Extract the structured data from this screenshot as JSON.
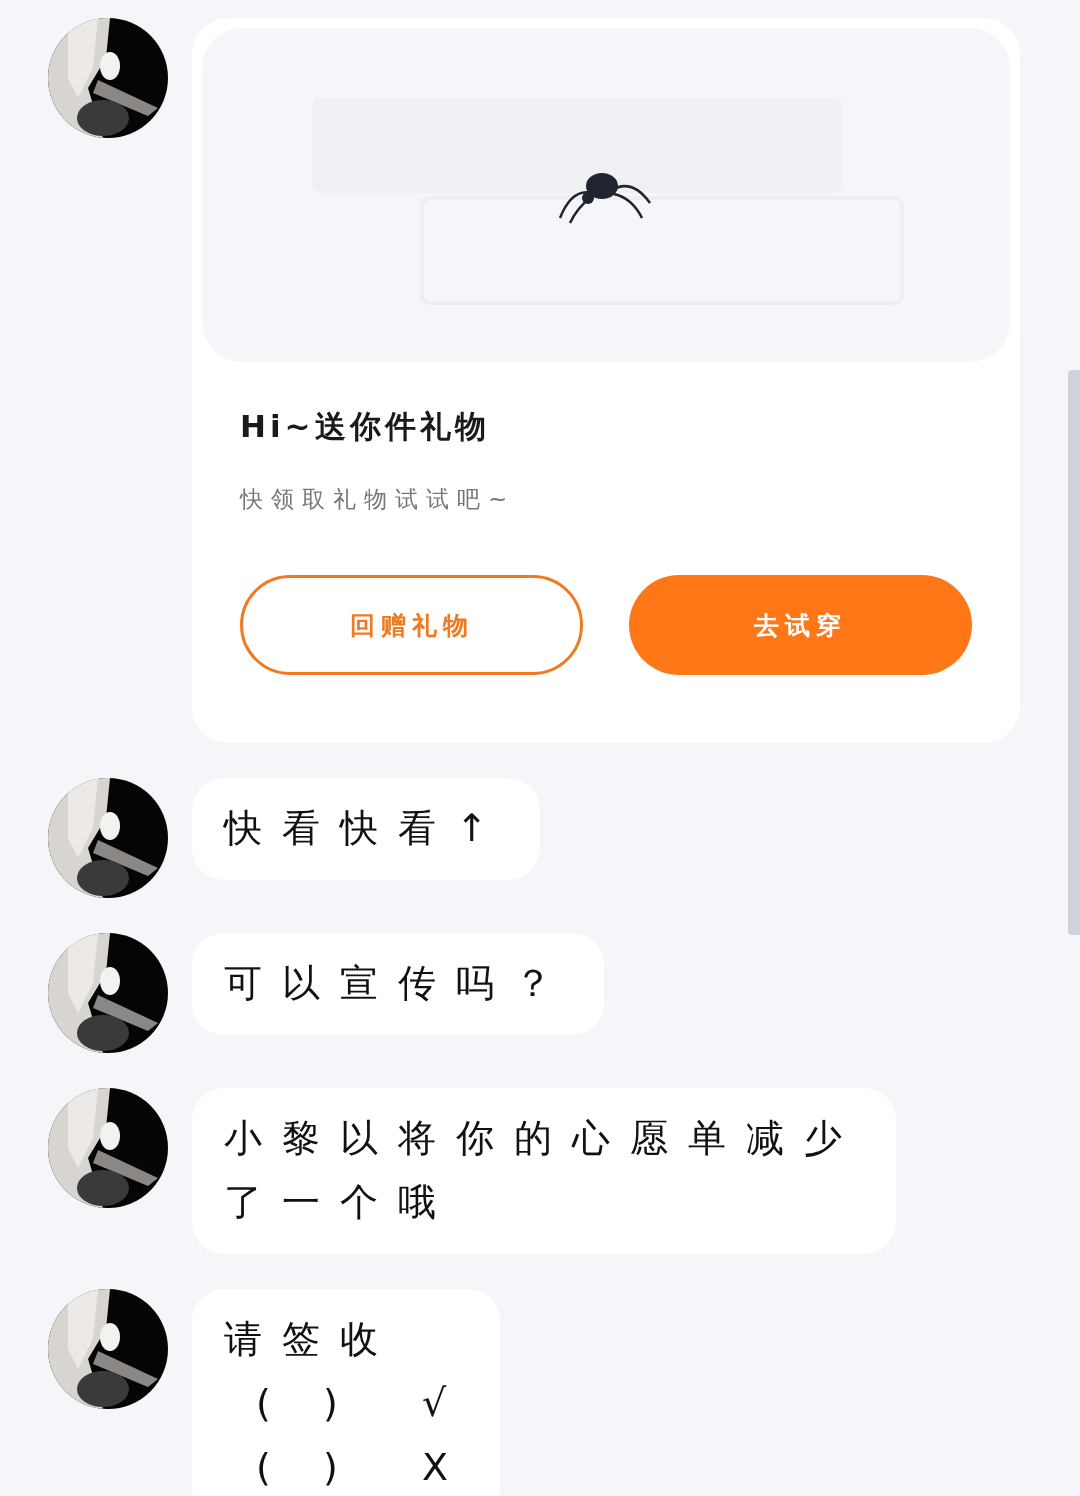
{
  "messages": [
    {
      "kind": "gift_card",
      "title": "Hi~送你件礼物",
      "subtitle": "快领取礼物试试吧~",
      "buttons": [
        {
          "label": "回赠礼物",
          "kind": "outline"
        },
        {
          "label": "去试穿",
          "kind": "filled"
        }
      ]
    },
    {
      "kind": "text",
      "text": "快看快看↑"
    },
    {
      "kind": "text",
      "text": "可以宣传吗？"
    },
    {
      "kind": "text",
      "text": "小黎以将你的心愿单减少了一个哦"
    },
    {
      "kind": "text",
      "text": "请签收\n ( )  √\n ( )  X"
    }
  ]
}
